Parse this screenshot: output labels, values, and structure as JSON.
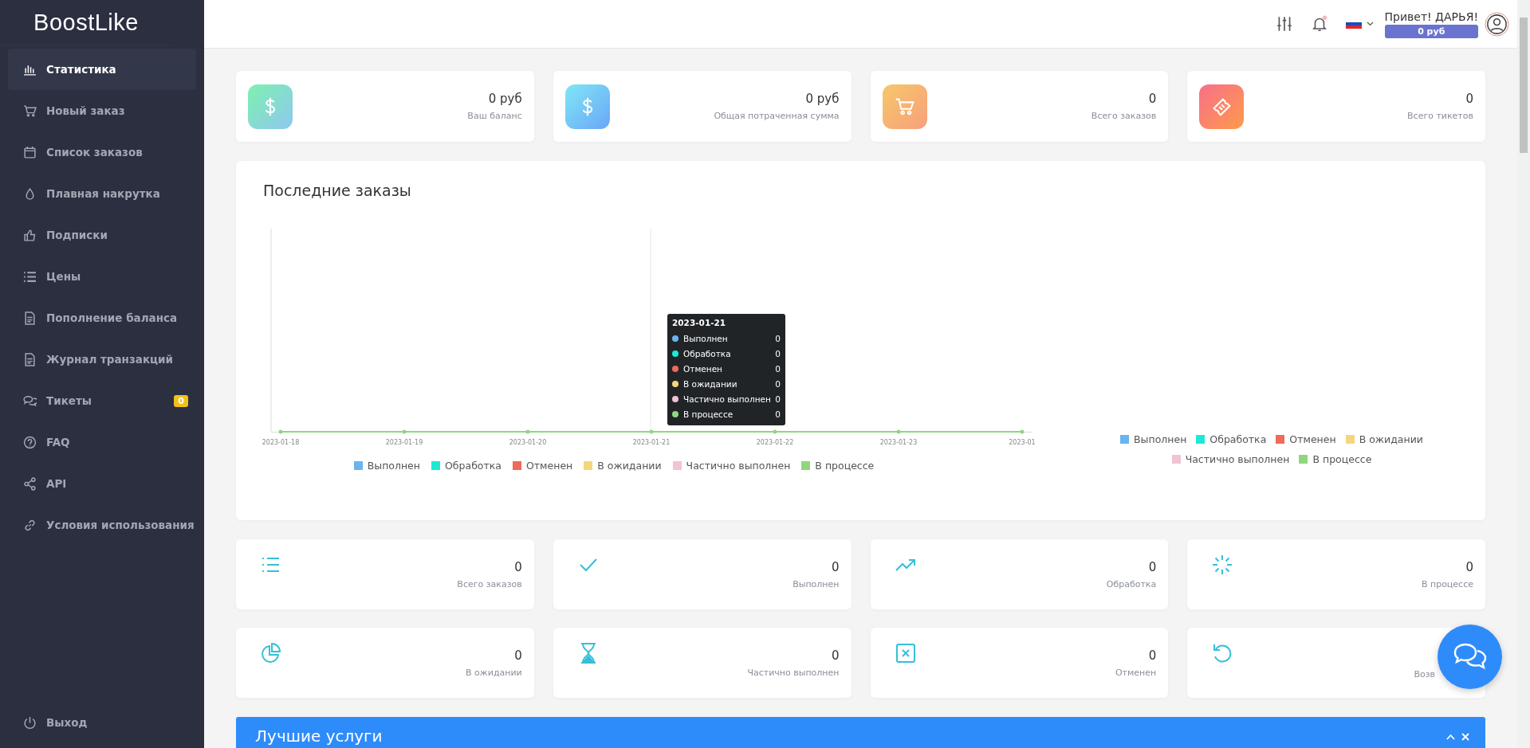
{
  "sidebar": {
    "logo": "BoostLike",
    "items": [
      {
        "label": "Статистика",
        "selected": true
      },
      {
        "label": "Новый заказ",
        "selected": false
      },
      {
        "label": "Список заказов",
        "selected": false
      },
      {
        "label": "Плавная накрутка",
        "selected": false
      },
      {
        "label": "Подписки",
        "selected": false
      },
      {
        "label": "Цены",
        "selected": false
      },
      {
        "label": "Пополнение баланса",
        "selected": false
      },
      {
        "label": "Журнал транзакций",
        "selected": false
      },
      {
        "label": "Тикеты",
        "selected": false,
        "badge": "0"
      },
      {
        "label": "FAQ",
        "selected": false
      },
      {
        "label": "API",
        "selected": false
      },
      {
        "label": "Условия использования",
        "selected": false
      }
    ],
    "logout": "Выход"
  },
  "header": {
    "greeting": "Привет! ДАРЬЯ!",
    "balance": "0 руб"
  },
  "stat_cards": [
    {
      "value": "0 руб",
      "label": "Ваш баланс"
    },
    {
      "value": "0 руб",
      "label": "Общая потраченная сумма"
    },
    {
      "value": "0",
      "label": "Всего заказов"
    },
    {
      "value": "0",
      "label": "Всего тикетов"
    }
  ],
  "recent_orders": {
    "title": "Последние заказы",
    "x_labels": [
      "2023-01-18",
      "2023-01-19",
      "2023-01-20",
      "2023-01-21",
      "2023-01-22",
      "2023-01-23",
      "2023-01"
    ],
    "legend": [
      {
        "name": "Выполнен",
        "color": "#6ab4f0"
      },
      {
        "name": "Обработка",
        "color": "#1de9d6"
      },
      {
        "name": "Отменен",
        "color": "#f0695a"
      },
      {
        "name": "В ожидании",
        "color": "#f5d67a"
      },
      {
        "name": "Частично выполнен",
        "color": "#f0c4d0"
      },
      {
        "name": "В процессе",
        "color": "#8fd67f"
      }
    ],
    "tooltip": {
      "title": "2023-01-21",
      "rows": [
        {
          "label": "Выполнен",
          "value": "0",
          "color": "#6ab4f0"
        },
        {
          "label": "Обработка",
          "value": "0",
          "color": "#1de9d6"
        },
        {
          "label": "Отменен",
          "value": "0",
          "color": "#f0695a"
        },
        {
          "label": "В ожидании",
          "value": "0",
          "color": "#f5d67a"
        },
        {
          "label": "Частично выполнен",
          "value": "0",
          "color": "#f0c4d0"
        },
        {
          "label": "В процессе",
          "value": "0",
          "color": "#8fd67f"
        }
      ]
    },
    "side_legend": [
      {
        "label": "Выполнен",
        "color": "#6ab4f0"
      },
      {
        "label": "Обработка",
        "color": "#1de9d6"
      },
      {
        "label": "Отменен",
        "color": "#f0695a"
      },
      {
        "label": "В ожидании",
        "color": "#f5d67a"
      },
      {
        "label": "Частично выполнен",
        "color": "#f0c4d0"
      },
      {
        "label": "В процессе",
        "color": "#8fd67f"
      }
    ]
  },
  "order_cards": [
    {
      "value": "0",
      "label": "Всего заказов"
    },
    {
      "value": "0",
      "label": "Выполнен"
    },
    {
      "value": "0",
      "label": "Обработка"
    },
    {
      "value": "0",
      "label": "В процессе"
    },
    {
      "value": "0",
      "label": "В ожидании"
    },
    {
      "value": "0",
      "label": "Частично выполнен"
    },
    {
      "value": "0",
      "label": "Отменен"
    },
    {
      "label": "Возв"
    }
  ],
  "best_services": {
    "title": "Лучшие услуги"
  }
}
